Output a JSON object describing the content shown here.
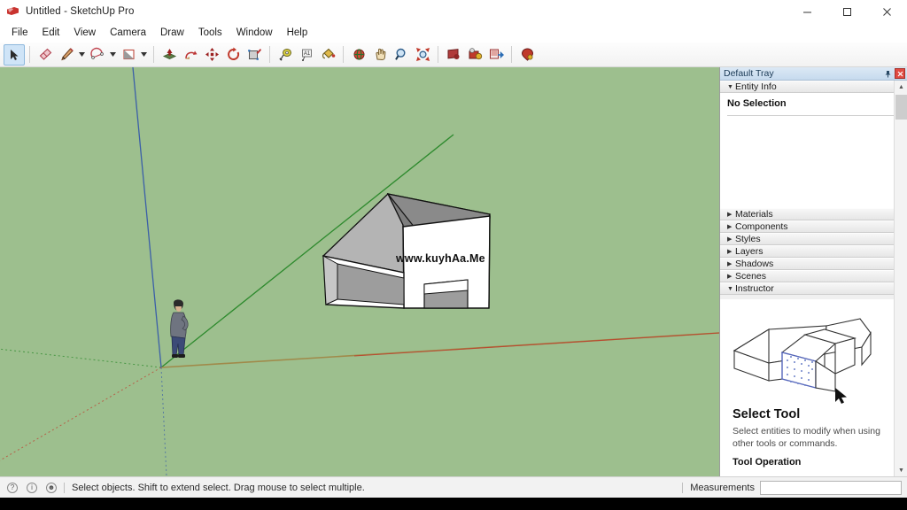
{
  "window": {
    "title": "Untitled - SketchUp Pro",
    "app_icon": "sketchup-logo-icon",
    "controls": [
      {
        "name": "minimize-button",
        "glyph": "minimize-icon"
      },
      {
        "name": "maximize-button",
        "glyph": "maximize-icon"
      },
      {
        "name": "close-button",
        "glyph": "close-icon"
      }
    ]
  },
  "menubar": {
    "items": [
      {
        "label": "File"
      },
      {
        "label": "Edit"
      },
      {
        "label": "View"
      },
      {
        "label": "Camera"
      },
      {
        "label": "Draw"
      },
      {
        "label": "Tools"
      },
      {
        "label": "Window"
      },
      {
        "label": "Help"
      }
    ]
  },
  "toolbar": {
    "tools": [
      {
        "name": "select-tool",
        "icon": "arrow-cursor-icon",
        "active": true
      },
      {
        "name": "eraser-tool",
        "icon": "eraser-icon",
        "active": false
      },
      {
        "name": "line-tool",
        "icon": "pencil-icon",
        "active": false
      },
      {
        "name": "arc-tool",
        "icon": "arc-icon",
        "active": false
      },
      {
        "name": "rectangle-tool",
        "icon": "rectangle-icon",
        "active": false
      },
      {
        "name": "pushpull-tool",
        "icon": "push-pull-icon",
        "active": false
      },
      {
        "name": "followme-tool",
        "icon": "follow-me-icon",
        "active": false
      },
      {
        "name": "move-tool",
        "icon": "move-arrows-icon",
        "active": false
      },
      {
        "name": "rotate-tool",
        "icon": "rotate-icon",
        "active": false
      },
      {
        "name": "scale-tool",
        "icon": "scale-icon",
        "active": false
      },
      {
        "name": "tape-measure-tool",
        "icon": "tape-measure-icon",
        "active": false
      },
      {
        "name": "dimension-tool",
        "icon": "text-label-icon",
        "active": false
      },
      {
        "name": "paint-bucket-tool",
        "icon": "paint-bucket-icon",
        "active": false
      },
      {
        "name": "orbit-tool",
        "icon": "orbit-icon",
        "active": false
      },
      {
        "name": "pan-tool",
        "icon": "hand-icon",
        "active": false
      },
      {
        "name": "zoom-tool",
        "icon": "magnifier-icon",
        "active": false
      },
      {
        "name": "zoom-extents-tool",
        "icon": "zoom-extents-icon",
        "active": false
      },
      {
        "name": "previous-view-tool",
        "icon": "previous-view-icon",
        "active": false
      },
      {
        "name": "position-camera-tool",
        "icon": "position-camera-icon",
        "active": false
      },
      {
        "name": "section-plane-tool",
        "icon": "section-plane-icon",
        "active": false
      },
      {
        "name": "walk-tool",
        "icon": "walk-icon",
        "active": false
      }
    ]
  },
  "viewport": {
    "background_color": "#9dbf8e",
    "watermark": "www.kuyhAa.Me",
    "axes": {
      "red_axis_color": "#c0392b",
      "green_axis_color": "#2d8a2d",
      "blue_axis_color": "#3b5fa8"
    },
    "model": {
      "name": "house-model",
      "wall_color": "#ffffff",
      "roof_color": "#9a9a9a",
      "edge_color": "#111111"
    },
    "scale_figure": {
      "name": "scale-figure-person"
    }
  },
  "tray": {
    "title": "Default Tray",
    "pin_icon": "pin-icon",
    "close_icon": "close-icon",
    "panels": [
      {
        "name": "entity-info",
        "label": "Entity Info",
        "expanded": true,
        "arrow": "▼"
      },
      {
        "name": "materials",
        "label": "Materials",
        "expanded": false,
        "arrow": "▶"
      },
      {
        "name": "components",
        "label": "Components",
        "expanded": false,
        "arrow": "▶"
      },
      {
        "name": "styles",
        "label": "Styles",
        "expanded": false,
        "arrow": "▶"
      },
      {
        "name": "layers",
        "label": "Layers",
        "expanded": false,
        "arrow": "▶"
      },
      {
        "name": "shadows",
        "label": "Shadows",
        "expanded": false,
        "arrow": "▶"
      },
      {
        "name": "scenes",
        "label": "Scenes",
        "expanded": false,
        "arrow": "▶"
      },
      {
        "name": "instructor",
        "label": "Instructor",
        "expanded": true,
        "arrow": "▼"
      }
    ],
    "entity_info": {
      "status": "No Selection"
    },
    "instructor": {
      "heading": "Select Tool",
      "description": "Select entities to modify when using other tools or commands.",
      "subheading": "Tool Operation",
      "illustration": "house-with-selected-face-diagram",
      "selection_color": "#6a7fc8"
    },
    "scrollbar": {
      "up_arrow": "▲",
      "down_arrow": "▼"
    }
  },
  "statusbar": {
    "icons": [
      {
        "name": "help-hint-icon",
        "glyph": "?"
      },
      {
        "name": "info-icon",
        "glyph": "i"
      },
      {
        "name": "account-icon",
        "glyph": "☻"
      }
    ],
    "message": "Select objects. Shift to extend select. Drag mouse to select multiple.",
    "measurements_label": "Measurements",
    "measurements_value": "",
    "measurements_placeholder": ""
  }
}
